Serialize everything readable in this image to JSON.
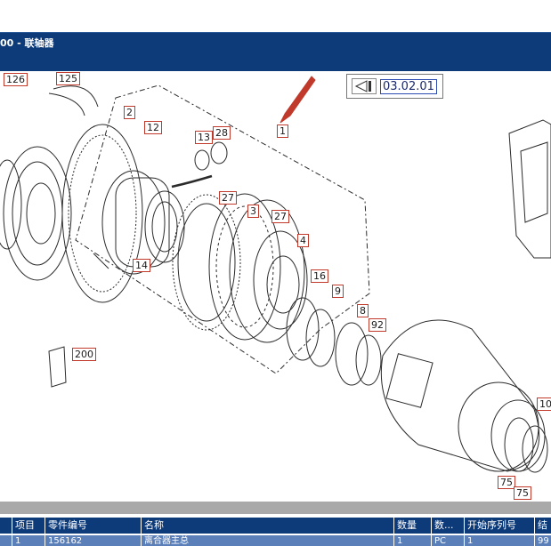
{
  "header": {
    "title": "00 - 联轴器"
  },
  "drawing": {
    "reference": "03.02.01",
    "callouts": [
      "126",
      "125",
      "2",
      "12",
      "13",
      "28",
      "1",
      "27",
      "3",
      "27",
      "4",
      "14",
      "16",
      "9",
      "8",
      "92",
      "200",
      "10",
      "75",
      "75"
    ]
  },
  "table": {
    "columns": [
      "项目",
      "零件编号",
      "名称",
      "数量",
      "数...",
      "开始序列号",
      "结"
    ],
    "row": [
      "1",
      "156162",
      "离合器主总",
      "1",
      "PC",
      "1",
      "99"
    ]
  }
}
